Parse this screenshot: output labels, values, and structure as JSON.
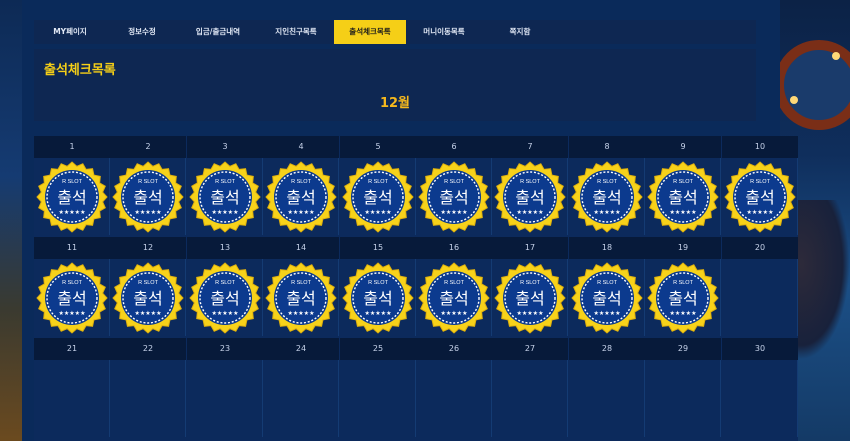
{
  "tabs": [
    {
      "label": "MY페이지",
      "active": false
    },
    {
      "label": "정보수정",
      "active": false
    },
    {
      "label": "입금/출금내역",
      "active": false
    },
    {
      "label": "지인친구목록",
      "active": false
    },
    {
      "label": "출석체크목록",
      "active": true
    },
    {
      "label": "머니이동목록",
      "active": false
    },
    {
      "label": "쪽지함",
      "active": false
    }
  ],
  "page_title": "출석체크목록",
  "month": "12월",
  "badge": {
    "top_text": "R SLOT",
    "main_text": "출석",
    "stars": "★★★★★"
  },
  "days": [
    1,
    2,
    3,
    4,
    5,
    6,
    7,
    8,
    9,
    10,
    11,
    12,
    13,
    14,
    15,
    16,
    17,
    18,
    19,
    20,
    21,
    22,
    23,
    24,
    25,
    26,
    27,
    28,
    29,
    30
  ],
  "attended_days": [
    1,
    2,
    3,
    4,
    5,
    6,
    7,
    8,
    9,
    10,
    11,
    12,
    13,
    14,
    15,
    16,
    17,
    18,
    19
  ],
  "colors": {
    "accent": "#f5cf17",
    "panel": "#0a2a5a",
    "badge_blue": "#0c3a8e"
  }
}
